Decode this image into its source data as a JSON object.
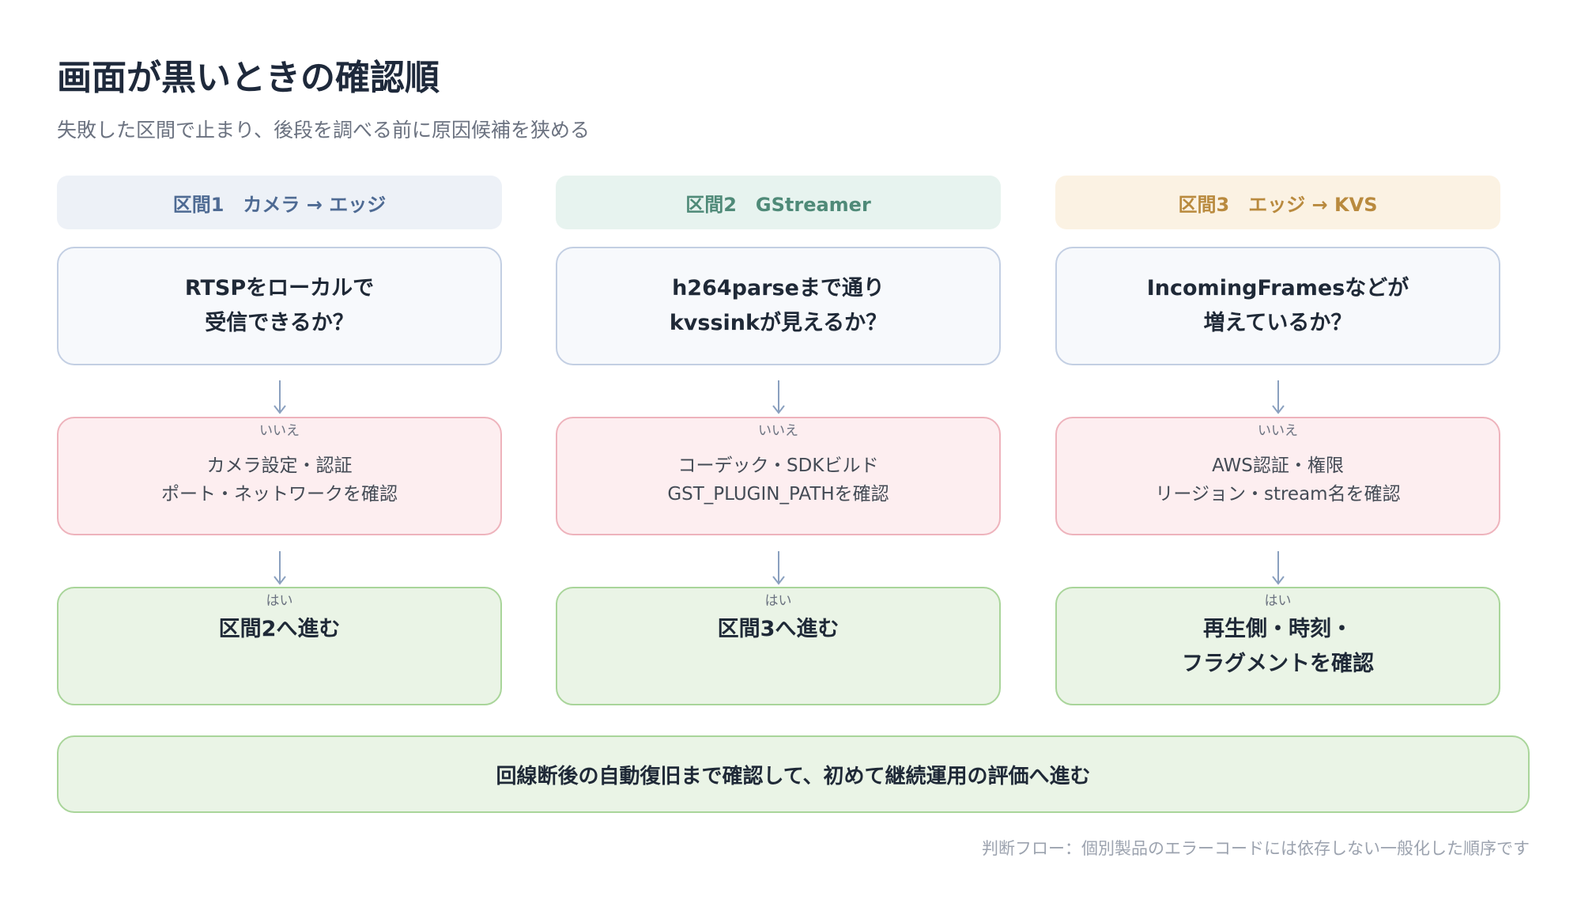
{
  "title": "画面が黒いときの確認順",
  "subtitle": "失敗した区間で止まり、後段を調べる前に原因候補を狭める",
  "sections": [
    {
      "header": "区間1　カメラ → エッジ",
      "question": [
        "RTSPをローカルで",
        "受信できるか？"
      ],
      "no_tag": "いいえ",
      "no_lines": [
        "カメラ設定・認証",
        "ポート・ネットワークを確認"
      ],
      "yes_tag": "はい",
      "yes_lines": [
        "区間2へ進む"
      ]
    },
    {
      "header": "区間2　GStreamer",
      "question": [
        "h264parseまで通り",
        "kvssinkが見えるか？"
      ],
      "no_tag": "いいえ",
      "no_lines": [
        "コーデック・SDKビルド",
        "GST_PLUGIN_PATHを確認"
      ],
      "yes_tag": "はい",
      "yes_lines": [
        "区間3へ進む"
      ]
    },
    {
      "header": "区間3　エッジ → KVS",
      "question": [
        "IncomingFramesなどが",
        "増えているか？"
      ],
      "no_tag": "いいえ",
      "no_lines": [
        "AWS認証・権限",
        "リージョン・stream名を確認"
      ],
      "yes_tag": "はい",
      "yes_lines": [
        "再生側・時刻・",
        "フラグメントを確認"
      ]
    }
  ],
  "banner": "回線断後の自動復旧まで確認して、初めて継続運用の評価へ進む",
  "footnote": "判断フロー：個別製品のエラーコードには依存しない一般化した順序です",
  "colors": {
    "arrow": "#8aa0bf",
    "no_border": "#eeb3bc",
    "yes_border": "#a9d59a",
    "question_border": "#c3cfe3"
  }
}
